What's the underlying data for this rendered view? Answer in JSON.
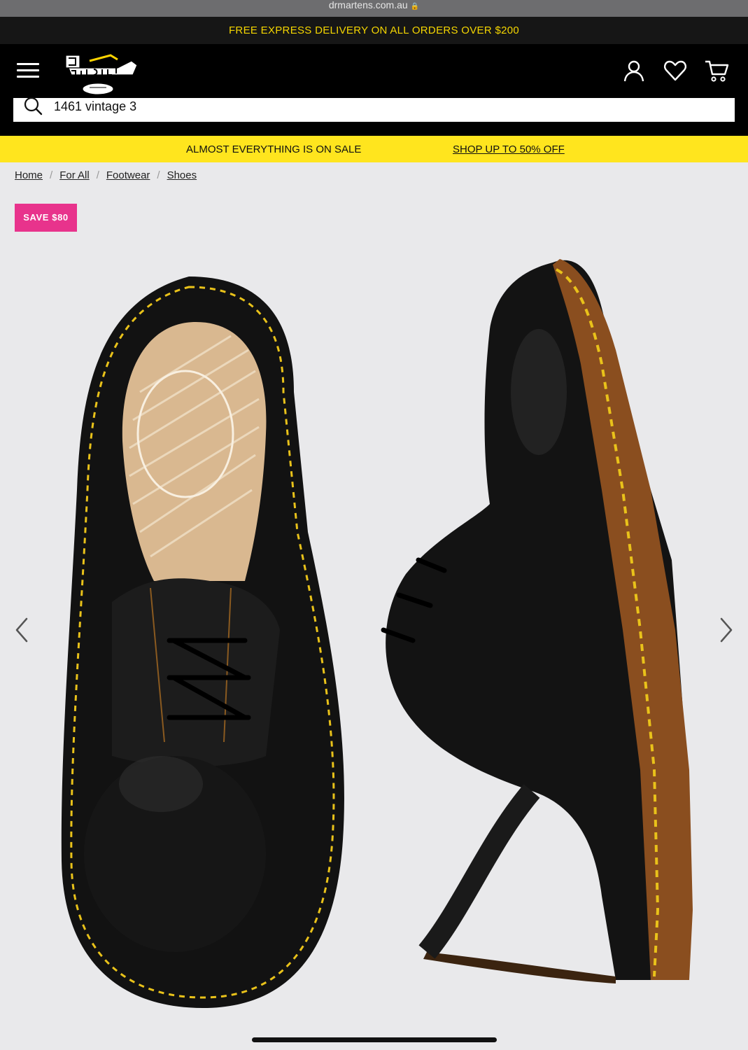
{
  "browser": {
    "url": "drmartens.com.au"
  },
  "promo_bar": {
    "text": "FREE EXPRESS DELIVERY ON ALL ORDERS OVER $200"
  },
  "header": {
    "logo_text": "Dr. Martens AirWair",
    "icons": [
      "menu-icon",
      "account-icon",
      "wishlist-heart-icon",
      "cart-icon"
    ]
  },
  "search": {
    "value": "1461 vintage 3",
    "icon": "search-icon"
  },
  "sale_banner": {
    "text": "ALMOST EVERYTHING IS ON SALE",
    "link": "SHOP UP TO 50% OFF"
  },
  "breadcrumb": [
    "Home",
    "For All",
    "Footwear",
    "Shoes"
  ],
  "product": {
    "badge": "SAVE $80",
    "image_alt": "black leather 3-eye shoes with yellow welt stitching",
    "nav_icons": [
      "chevron-left-icon",
      "chevron-right-icon"
    ]
  },
  "colors": {
    "promo_text": "#f5d600",
    "sale_banner_bg": "#ffe51e",
    "badge_bg": "#e8338c"
  }
}
